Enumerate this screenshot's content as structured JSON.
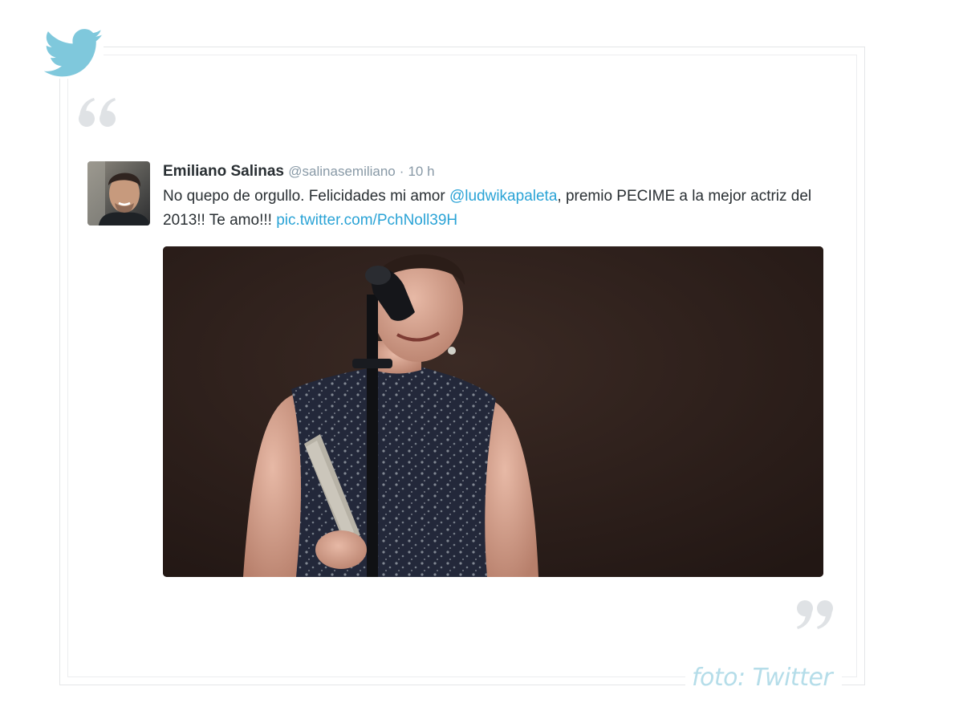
{
  "icons": {
    "brand": "twitter-bird-icon",
    "open_quote": "open-quote-icon",
    "close_quote": "close-quote-icon"
  },
  "colors": {
    "twitter_blue": "#7fc8dc",
    "link": "#2aa3d6",
    "text": "#292f33",
    "muted": "#8899a6",
    "quote_mark": "#dfe2e5",
    "credit": "#b5dde9"
  },
  "tweet": {
    "author_name": "Emiliano Salinas",
    "author_handle": "@salinasemiliano",
    "separator": "·",
    "timestamp": "10 h",
    "text_part1": "No quepo de orgullo. Felicidades mi amor ",
    "mention": "@ludwikapaleta",
    "text_part2": ", premio PECIME a la mejor actriz del 2013!! Te amo!!! ",
    "pic_link": "pic.twitter.com/PchNoll39H"
  },
  "credit": "foto: Twitter"
}
